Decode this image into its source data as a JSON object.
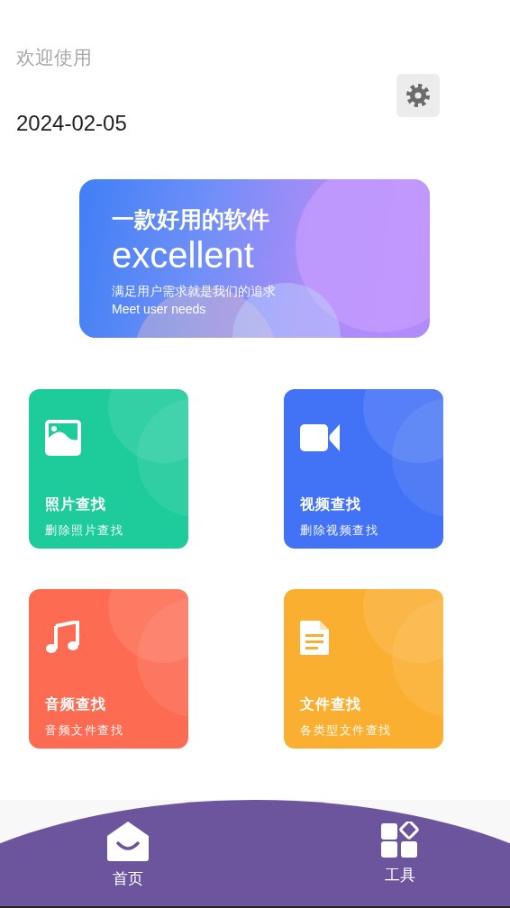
{
  "header": {
    "greeting": "欢迎使用",
    "date": "2024-02-05"
  },
  "banner": {
    "title": "一款好用的软件",
    "headline": "excellent",
    "subtitle": "满足用户需求就是我们的追求",
    "caption": "Meet user needs"
  },
  "tools": [
    {
      "kind": "image",
      "title": "照片查找",
      "subtitle": "删除照片查找",
      "color": "#1ecb9b"
    },
    {
      "kind": "video",
      "title": "视频查找",
      "subtitle": "删除视频查找",
      "color": "#4272f6"
    },
    {
      "kind": "music",
      "title": "音频查找",
      "subtitle": "音频文件查找",
      "color": "#fd6b52"
    },
    {
      "kind": "document",
      "title": "文件查找",
      "subtitle": "各类型文件查找",
      "color": "#fbaf31"
    }
  ],
  "nav": [
    {
      "kind": "home",
      "label": "首页"
    },
    {
      "kind": "tools",
      "label": "工具"
    }
  ]
}
